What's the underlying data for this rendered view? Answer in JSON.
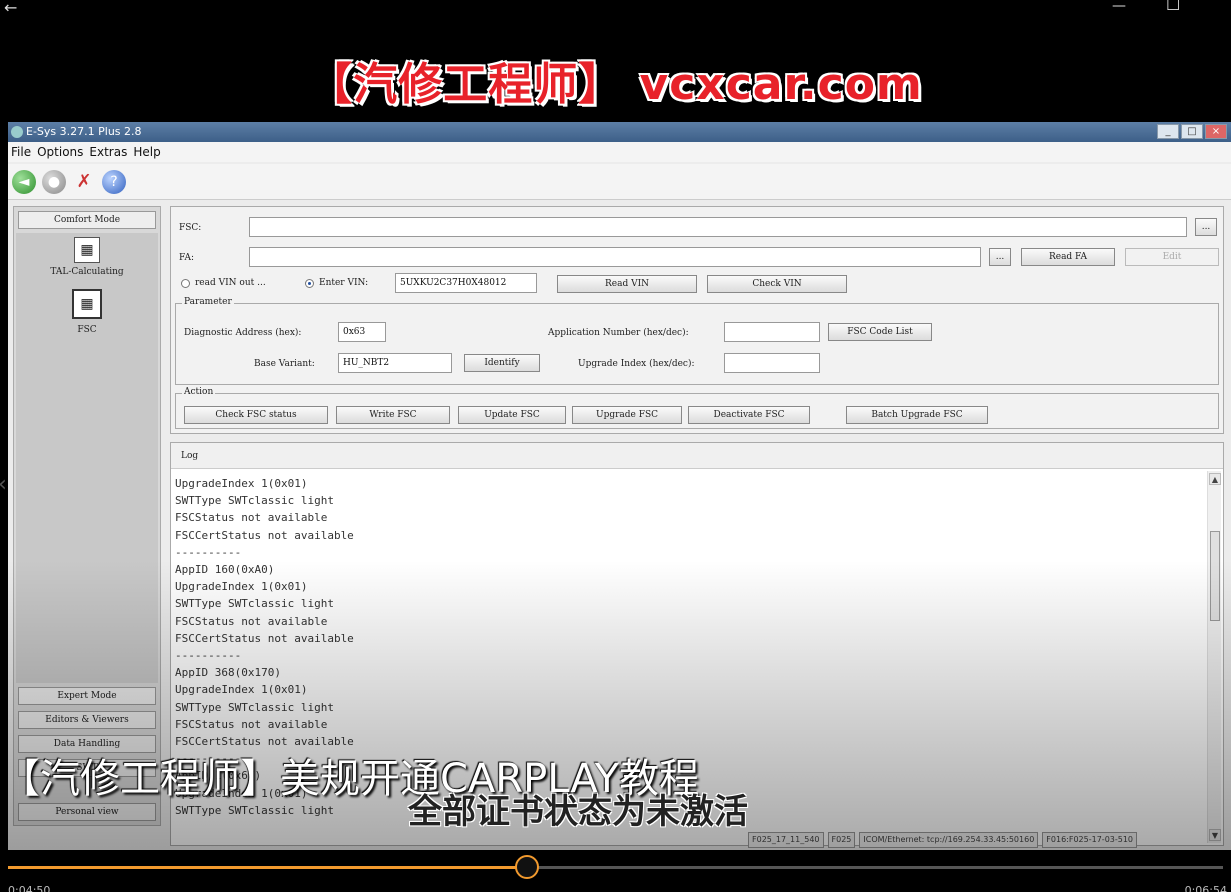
{
  "player": {
    "banner_title": "【汽修工程师】",
    "banner_url": "vcxcar.com",
    "caption_main": "【汽修工程师】美规开通CARPLAY教程",
    "caption_sub": "全部证书状态为未激活",
    "time_elapsed": "0:04:50",
    "time_total": "0:06:54",
    "progress": 0.427
  },
  "app": {
    "title": "E-Sys 3.27.1 Plus 2.8",
    "menu": [
      "File",
      "Options",
      "Extras",
      "Help"
    ],
    "toolbar_icons": [
      "connect-icon",
      "disconnect-icon",
      "tools-icon",
      "help-icon"
    ]
  },
  "leftpane": {
    "top_button": "Comfort Mode",
    "items": [
      {
        "label": "TAL-Calculating",
        "icon": "tal-calculating-icon"
      },
      {
        "label": "FSC",
        "icon": "fsc-icon"
      }
    ],
    "bottom_buttons": [
      "Expert Mode",
      "Editors & Viewers",
      "Data Handling",
      "SWT",
      "Personal view"
    ]
  },
  "form": {
    "fsc_label": "FSC:",
    "fsc_value": "",
    "fa_label": "FA:",
    "fa_value": "",
    "browse_label": "...",
    "read_fa_label": "Read FA",
    "edit_label": "Edit",
    "radio_read_vin": "read VIN out ...",
    "radio_enter_vin": "Enter VIN:",
    "vin_value": "5UXKU2C37H0X48012",
    "read_vin_label": "Read VIN",
    "check_vin_label": "Check VIN",
    "parameter": {
      "title": "Parameter",
      "diag_address_label": "Diagnostic Address (hex):",
      "diag_address_value": "0x63",
      "base_variant_label": "Base Variant:",
      "base_variant_value": "HU_NBT2",
      "identify_label": "Identify",
      "app_number_label": "Application Number (hex/dec):",
      "app_number_value": "",
      "fsc_code_list_label": "FSC Code List",
      "upgrade_index_label": "Upgrade Index (hex/dec):",
      "upgrade_index_value": ""
    },
    "action": {
      "title": "Action",
      "buttons": [
        "Check FSC status",
        "Write FSC",
        "Update FSC",
        "Upgrade FSC",
        "Deactivate FSC",
        "Batch Upgrade FSC"
      ]
    }
  },
  "log": {
    "title": "Log",
    "lines": [
      "UpgradeIndex 1(0x01)",
      "SWTType SWTclassic light",
      "FSCStatus not available",
      "FSCCertStatus not available",
      "----------",
      "AppID 160(0xA0)",
      "UpgradeIndex 1(0x01)",
      "SWTType SWTclassic light",
      "FSCStatus not available",
      "FSCCertStatus not available",
      "----------",
      "AppID 368(0x170)",
      "UpgradeIndex 1(0x01)",
      "SWTType SWTclassic light",
      "FSCStatus not available",
      "FSCCertStatus not available",
      "----------",
      "AppID 1(0x6F)",
      "UpgradeIndex 1(0x01)",
      "SWTType SWTclassic light"
    ]
  },
  "statusbar": [
    "F025_17_11_540",
    "F025",
    "ICOM/Ethernet: tcp://169.254.33.45:50160",
    "F016:F025-17-03-510"
  ]
}
